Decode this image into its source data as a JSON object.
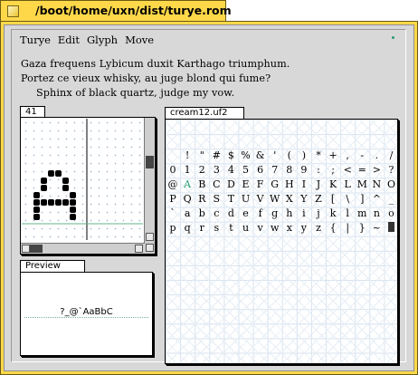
{
  "window": {
    "title": "/boot/home/uxn/dist/turye.rom"
  },
  "menubar": {
    "items": [
      "Turye",
      "Edit",
      "Glyph",
      "Move"
    ]
  },
  "sample_text": [
    "Gaza frequens Lybicum duxit Karthago triumphum.",
    "Portez ce vieux whisky, au juge blond qui fume?",
    "Sphinx of black quartz, judge my vow."
  ],
  "editor": {
    "tab_label": "41",
    "glyph_char": "A"
  },
  "preview": {
    "tab_label": "Preview",
    "text": "?_@`AaBbC"
  },
  "fontmap": {
    "tab_label": "cream12.uf2",
    "rows": [
      [
        " ",
        "!",
        "\"",
        "#",
        "$",
        "%",
        "&",
        "'",
        "(",
        ")",
        "*",
        "+",
        ",",
        "-",
        ".",
        "/"
      ],
      [
        "0",
        "1",
        "2",
        "3",
        "4",
        "5",
        "6",
        "7",
        "8",
        "9",
        ":",
        ";",
        "<",
        "=",
        ">",
        "?"
      ],
      [
        "@",
        "A",
        "B",
        "C",
        "D",
        "E",
        "F",
        "G",
        "H",
        "I",
        "J",
        "K",
        "L",
        "M",
        "N",
        "O"
      ],
      [
        "P",
        "Q",
        "R",
        "S",
        "T",
        "U",
        "V",
        "W",
        "X",
        "Y",
        "Z",
        "[",
        "\\",
        "]",
        "^",
        "_"
      ],
      [
        "`",
        "a",
        "b",
        "c",
        "d",
        "e",
        "f",
        "g",
        "h",
        "i",
        "j",
        "k",
        "l",
        "m",
        "n",
        "o"
      ],
      [
        "p",
        "q",
        "r",
        "s",
        "t",
        "u",
        "v",
        "w",
        "x",
        "y",
        "z",
        "{",
        "|",
        "}",
        "~",
        ""
      ]
    ],
    "selected_char": "A",
    "selected_color": "#28a070"
  }
}
